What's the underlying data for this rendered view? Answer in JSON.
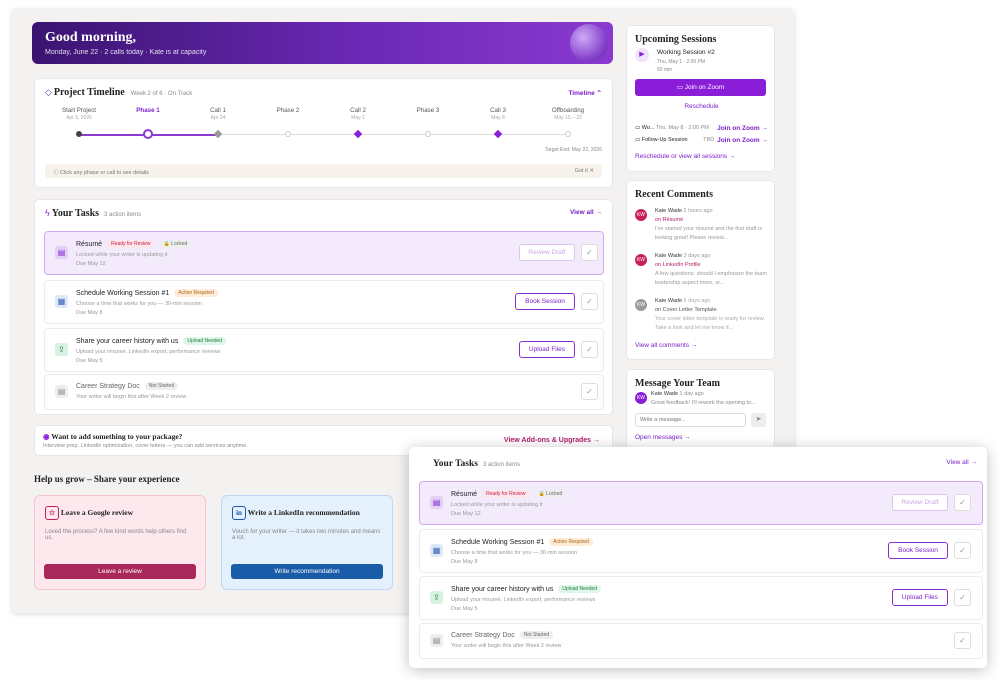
{
  "hero": {
    "greeting": "Good morning,",
    "subtitle": "Monday, June 22 · 2 calls today · Kate is at capacity"
  },
  "timeline": {
    "title": "Project Timeline",
    "week": "Week 2 of 6 · On Track",
    "toggle": "Timeline ⌃",
    "phases": [
      {
        "label": "Start Project",
        "date": "Apr 5, 2026"
      },
      {
        "label": "Phase 1",
        "date": ""
      },
      {
        "label": "Call 1",
        "date": "Apr 24"
      },
      {
        "label": "Phase 2",
        "date": ""
      },
      {
        "label": "Call 2",
        "date": "May 1"
      },
      {
        "label": "Phase 3",
        "date": ""
      },
      {
        "label": "Call 3",
        "date": "May 8"
      },
      {
        "label": "Offboarding",
        "date": "May 15 – 22"
      }
    ],
    "target": "Target End: May 22, 2026",
    "hint": "Click any phase or call to see details",
    "got_it": "Got it ✕"
  },
  "tasks": {
    "title": "Your Tasks",
    "count": "3 action items",
    "view_all": "View all →",
    "items": [
      {
        "name": "Résumé",
        "badge": "Ready for Review",
        "badge2": "🔒 Locked",
        "desc": "Locked while your writer is updating it",
        "due": "Due May 12",
        "action": "Review Draft"
      },
      {
        "name": "Schedule Working Session #1",
        "badge": "Action Required",
        "desc": "Choose a time that works for you — 30-min session",
        "due": "Due May 8",
        "action": "Book Session"
      },
      {
        "name": "Share your career history with us",
        "badge": "Upload Needed",
        "desc": "Upload your résumé, LinkedIn export, performance reviews",
        "due": "Due May 5",
        "action": "Upload Files"
      },
      {
        "name": "Career Strategy Doc",
        "badge": "Not Started",
        "desc": "Your writer will begin this after Week 2 review",
        "due": ""
      }
    ]
  },
  "addon": {
    "title": "Want to add something to your package?",
    "desc": "Interview prep, LinkedIn optimization, cover letters — you can add services anytime.",
    "link": "View Add-ons & Upgrades →"
  },
  "grow": {
    "title": "Help us grow – Share your experience",
    "google": {
      "title": "Leave a Google review",
      "desc": "Loved the process? A few kind words help others find us.",
      "button": "Leave a review"
    },
    "linkedin": {
      "title": "Write a LinkedIn recommendation",
      "desc": "Vouch for your writer — it takes two minutes and means a lot.",
      "button": "Write recommendation"
    }
  },
  "sessions": {
    "title": "Upcoming Sessions",
    "name": "Working Session #2",
    "date": "Thu, May 1 · 2:00 PM",
    "duration": "60 min",
    "join": "Join on Zoom",
    "reschedule": "Reschedule",
    "list": [
      {
        "name": "Wo...",
        "time": "Thu, May 8 · 2:00 PM",
        "link": "Join on Zoom →"
      },
      {
        "name": "Follow-Up Session",
        "time": "TBD",
        "link": "Join on Zoom →"
      }
    ],
    "footer": "Reschedule or view all sessions →"
  },
  "comments": {
    "title": "Recent Comments",
    "items": [
      {
        "initials": "KW",
        "author": "Kate Wade",
        "time": "2 hours ago",
        "on": "on Résumé",
        "text": "I've started your résumé and the first draft is looking great! Please review..."
      },
      {
        "initials": "KW",
        "author": "Kate Wade",
        "time": "3 days ago",
        "on": "on LinkedIn Profile",
        "text": "A few questions: should I emphasize the team leadership aspect more, or..."
      },
      {
        "initials": "KW",
        "author": "Kate Wade",
        "time": "5 days ago",
        "on": "on Cover Letter Template",
        "text": "Your cover letter template is ready for review. Take a look and let me know if..."
      }
    ],
    "view_all": "View all comments →"
  },
  "message": {
    "title": "Message Your Team",
    "author": "Kate Wade",
    "time": "1 day ago",
    "preview": "Great feedback! I'll rework the opening to...",
    "placeholder": "Write a message...",
    "open": "Open messages →"
  },
  "colors": {
    "accent": "#7a1ec8",
    "google_btn": "#a8285a",
    "linkedin_btn": "#1a5ca8"
  }
}
